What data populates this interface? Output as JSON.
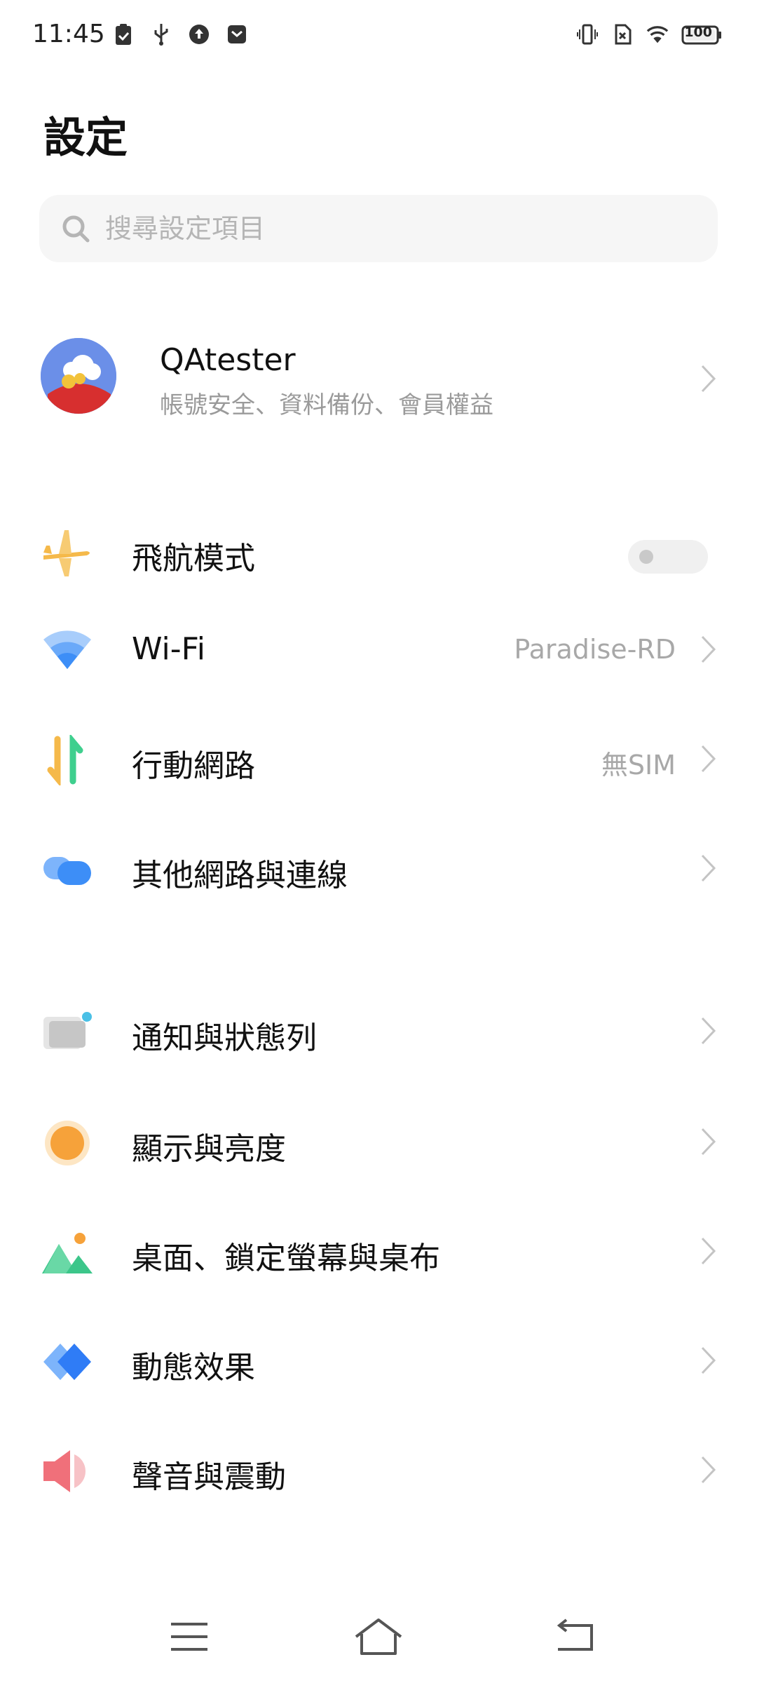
{
  "status_bar": {
    "time": "11:45",
    "battery": "100",
    "left_icons": [
      "clipboard-check-icon",
      "usb-icon",
      "upload-icon",
      "mail-icon"
    ],
    "right_icons": [
      "vibrate-icon",
      "no-sim-icon",
      "wifi-icon",
      "battery-icon"
    ]
  },
  "header": {
    "title": "設定"
  },
  "search": {
    "placeholder": "搜尋設定項目"
  },
  "account": {
    "name": "QAtester",
    "subtitle": "帳號安全、資料備份、會員權益"
  },
  "settings": [
    {
      "label": "飛航模式",
      "icon": "airplane-icon",
      "toggle_on": false
    },
    {
      "label": "Wi-Fi",
      "value": "Paradise-RD",
      "icon": "wifi-icon"
    },
    {
      "label": "行動網路",
      "value": "無SIM",
      "icon": "mobile-data-icon"
    },
    {
      "label": "其他網路與連線",
      "icon": "connection-icon"
    },
    {
      "label": "通知與狀態列",
      "icon": "notification-icon"
    },
    {
      "label": "顯示與亮度",
      "icon": "brightness-icon"
    },
    {
      "label": "桌面、鎖定螢幕與桌布",
      "icon": "wallpaper-icon"
    },
    {
      "label": "動態效果",
      "icon": "animation-icon"
    },
    {
      "label": "聲音與震動",
      "icon": "sound-icon"
    }
  ],
  "nav_bar": {
    "buttons": [
      "menu-icon",
      "home-icon",
      "back-icon"
    ]
  },
  "colors": {
    "airplane": "#f5b94a",
    "wifi": "#3d8ef7",
    "mobile_data_up": "#3fcf8e",
    "mobile_data_down": "#f5b94a",
    "connection": "#3d8ef7",
    "notification": "#cfcfcf",
    "brightness": "#f6a23a",
    "wallpaper": "#3cc68a",
    "animation": "#2f7cf6",
    "sound": "#f0707a"
  }
}
